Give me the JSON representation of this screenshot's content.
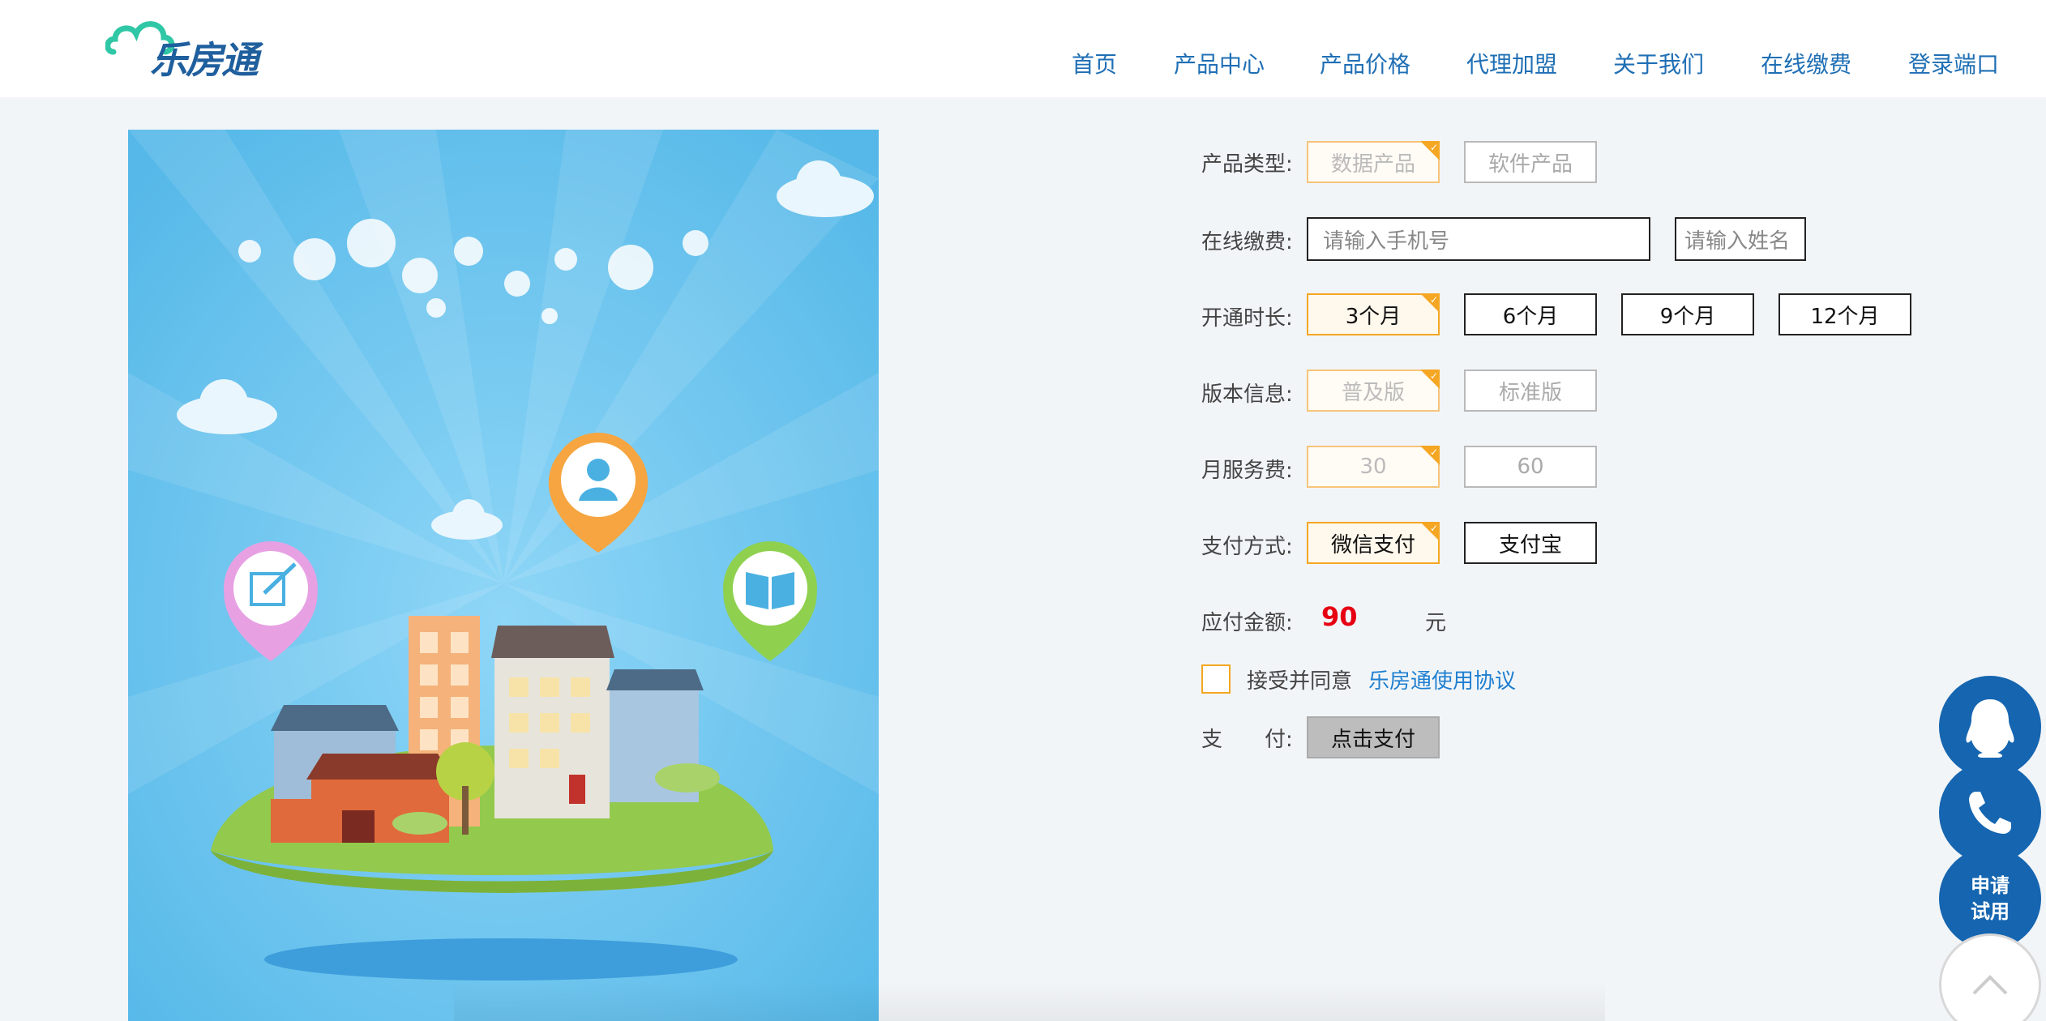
{
  "brand": {
    "name": "乐房通"
  },
  "nav": {
    "items": [
      "首页",
      "产品中心",
      "产品价格",
      "代理加盟",
      "关于我们",
      "在线缴费",
      "登录端口"
    ]
  },
  "form": {
    "product_type": {
      "label": "产品类型:",
      "options": [
        "数据产品",
        "软件产品"
      ],
      "selected": "数据产品"
    },
    "online_pay": {
      "label": "在线缴费:",
      "phone_placeholder": "请输入手机号",
      "name_placeholder": "请输入姓名"
    },
    "duration": {
      "label": "开通时长:",
      "options": [
        "3个月",
        "6个月",
        "9个月",
        "12个月"
      ],
      "selected": "3个月"
    },
    "version": {
      "label": "版本信息:",
      "options": [
        "普及版",
        "标准版"
      ],
      "selected": "普及版"
    },
    "monthly_fee": {
      "label": "月服务费:",
      "options": [
        "30",
        "60"
      ],
      "selected": "30"
    },
    "payment_method": {
      "label": "支付方式:",
      "options": [
        "微信支付",
        "支付宝"
      ],
      "selected": "微信支付"
    },
    "amount": {
      "label": "应付金额:",
      "value": "90",
      "unit": "元"
    },
    "agreement": {
      "text": "接受并同意",
      "link": "乐房通使用协议"
    },
    "pay": {
      "label": "支　　付:",
      "button": "点击支付"
    }
  },
  "side_buttons": {
    "qq": "qq-icon",
    "phone": "phone-icon",
    "trial": "申请\n试用",
    "top": "chevron-up-icon"
  },
  "colors": {
    "brand_blue": "#1f6fb5",
    "accent_orange": "#f5a623",
    "price_red": "#e60012",
    "float_blue": "#1565b0"
  }
}
